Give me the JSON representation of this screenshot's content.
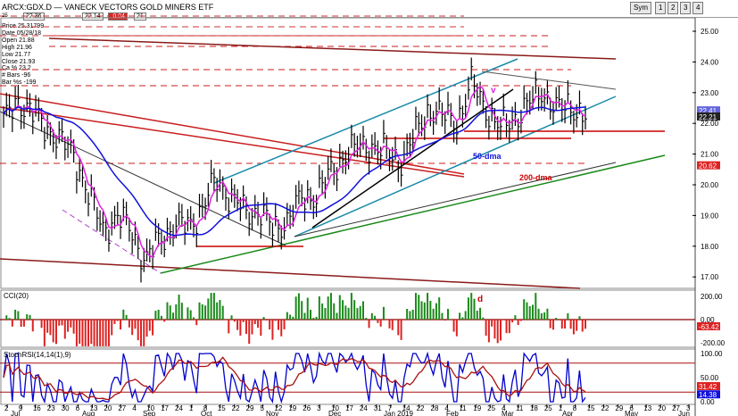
{
  "window": {
    "symbol": "ARCX:GDX.D",
    "title": "VANECK VECTORS GOLD MINERS ETF",
    "field_a": "22.36",
    "field_b": "22.14",
    "field_c": "-0.04",
    "field_d": "21",
    "left_box": "25",
    "buttons": [
      "Sym",
      "1",
      "2",
      "3",
      "4"
    ]
  },
  "info_panel": [
    "Price  25.31799",
    "Date   05/28/18",
    "Open   21.88",
    "High   21.96",
    "Low    21.77",
    "Close  21.93",
    "Ca %  23.2",
    "# Bars -96",
    "Bar %s -199"
  ],
  "colors": {
    "price_bars": "#000000",
    "ma_magenta": "#e020e0",
    "ma_blue": "#1010dd",
    "ma_red": "#cc0000",
    "trend_teal": "#1a8aaa",
    "trend_green": "#1a8a1a",
    "cci_pos": "#1a8a1a",
    "cci_neg": "#dd2222",
    "stoch_blue": "#0000cc",
    "stoch_red": "#aa1111",
    "price_tag": "#dd2222"
  },
  "chart_data": {
    "type": "bar",
    "price_panel": {
      "y_ticks": [
        "25.00",
        "24.00",
        "23.00",
        "22.00",
        "21.00",
        "20.00",
        "19.00",
        "18.00",
        "17.00"
      ],
      "ylim": [
        16.8,
        25.3
      ],
      "tags": [
        "22.41",
        "22.21",
        "20.62"
      ],
      "annotations": [
        "50-dma",
        "200-dma",
        "v"
      ],
      "ohlc_approx": [
        {
          "d": "Jul 1",
          "c": 22.0
        },
        {
          "d": "Jul 9",
          "c": 22.8
        },
        {
          "d": "Jul 16",
          "c": 22.3
        },
        {
          "d": "Jul 23",
          "c": 21.9
        },
        {
          "d": "Jul 30",
          "c": 21.4
        },
        {
          "d": "Aug 6",
          "c": 21.0
        },
        {
          "d": "Aug 13",
          "c": 19.6
        },
        {
          "d": "Aug 20",
          "c": 18.6
        },
        {
          "d": "Aug 27",
          "c": 18.9
        },
        {
          "d": "Sep 3",
          "c": 18.6
        },
        {
          "d": "Sep 10",
          "c": 17.4
        },
        {
          "d": "Sep 17",
          "c": 18.3
        },
        {
          "d": "Sep 24",
          "c": 18.6
        },
        {
          "d": "Oct 1",
          "c": 18.7
        },
        {
          "d": "Oct 8",
          "c": 19.2
        },
        {
          "d": "Oct 15",
          "c": 20.2
        },
        {
          "d": "Oct 22",
          "c": 19.6
        },
        {
          "d": "Oct 29",
          "c": 19.1
        },
        {
          "d": "Nov 5",
          "c": 19.2
        },
        {
          "d": "Nov 12",
          "c": 18.5
        },
        {
          "d": "Nov 19",
          "c": 18.9
        },
        {
          "d": "Nov 26",
          "c": 19.5
        },
        {
          "d": "Dec 3",
          "c": 19.7
        },
        {
          "d": "Dec 10",
          "c": 20.3
        },
        {
          "d": "Dec 17",
          "c": 21.0
        },
        {
          "d": "Dec 24",
          "c": 21.2
        },
        {
          "d": "Dec 31",
          "c": 21.3
        },
        {
          "d": "Jan 7",
          "c": 21.0
        },
        {
          "d": "Jan 14",
          "c": 20.8
        },
        {
          "d": "Jan 21",
          "c": 21.6
        },
        {
          "d": "Jan 28",
          "c": 22.5
        },
        {
          "d": "Feb 4",
          "c": 22.2
        },
        {
          "d": "Feb 11",
          "c": 22.1
        },
        {
          "d": "Feb 18",
          "c": 23.3
        },
        {
          "d": "Feb 25",
          "c": 22.5
        },
        {
          "d": "Mar 4",
          "c": 21.8
        },
        {
          "d": "Mar 11",
          "c": 22.2
        },
        {
          "d": "Mar 18",
          "c": 22.6
        },
        {
          "d": "Mar 25",
          "c": 23.1
        },
        {
          "d": "Apr 1",
          "c": 22.4
        },
        {
          "d": "Apr 8",
          "c": 22.6
        },
        {
          "d": "Apr 15",
          "c": 22.2
        }
      ]
    },
    "cci_panel": {
      "title": "CCI(20)",
      "y_ticks": [
        "200.00",
        "0.00",
        "-200.00"
      ],
      "tag": "-63.42",
      "annotations": [
        "d"
      ]
    },
    "stoch_panel": {
      "title": "StochRSI(14,14(1),9)",
      "y_ticks": [
        "100.00",
        "50.00",
        "0.00"
      ],
      "tags": [
        "31.42",
        "14.38"
      ]
    },
    "x_axis": {
      "day_ticks": [
        "2",
        "9",
        "16",
        "23",
        "30",
        "6",
        "13",
        "20",
        "27",
        "4",
        "10",
        "17",
        "24",
        "1",
        "8",
        "15",
        "22",
        "29",
        "5",
        "12",
        "19",
        "26",
        "3",
        "10",
        "17",
        "24",
        "31",
        "7",
        "14",
        "22",
        "28",
        "4",
        "11",
        "19",
        "25",
        "4",
        "11",
        "18",
        "25",
        "1",
        "8",
        "15",
        "22",
        "29",
        "6",
        "13",
        "20",
        "27",
        "3"
      ],
      "months": [
        "Jul",
        "Aug",
        "Sep",
        "Oct",
        "Nov",
        "Dec",
        "Jan 2019",
        "Feb",
        "Mar",
        "Apr",
        "May",
        "Jun"
      ]
    }
  }
}
